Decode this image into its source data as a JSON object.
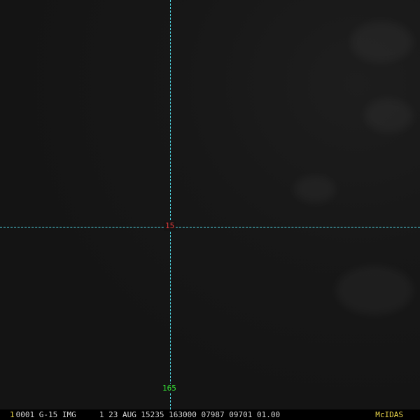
{
  "overlay": {
    "latitude_label": "15",
    "longitude_label": "165",
    "grid_color": "#4fd6e3",
    "latitude_label_color": "#e23b3b",
    "longitude_label_color": "#35e035"
  },
  "status_bar": {
    "frame_number": "1",
    "text": "0001 G-15 IMG     1 23 AUG 15235 163000 07987 09701 01.00",
    "brand": "McIDAS",
    "frame_number_color": "#e8d44a",
    "brand_color": "#e8d44a"
  }
}
